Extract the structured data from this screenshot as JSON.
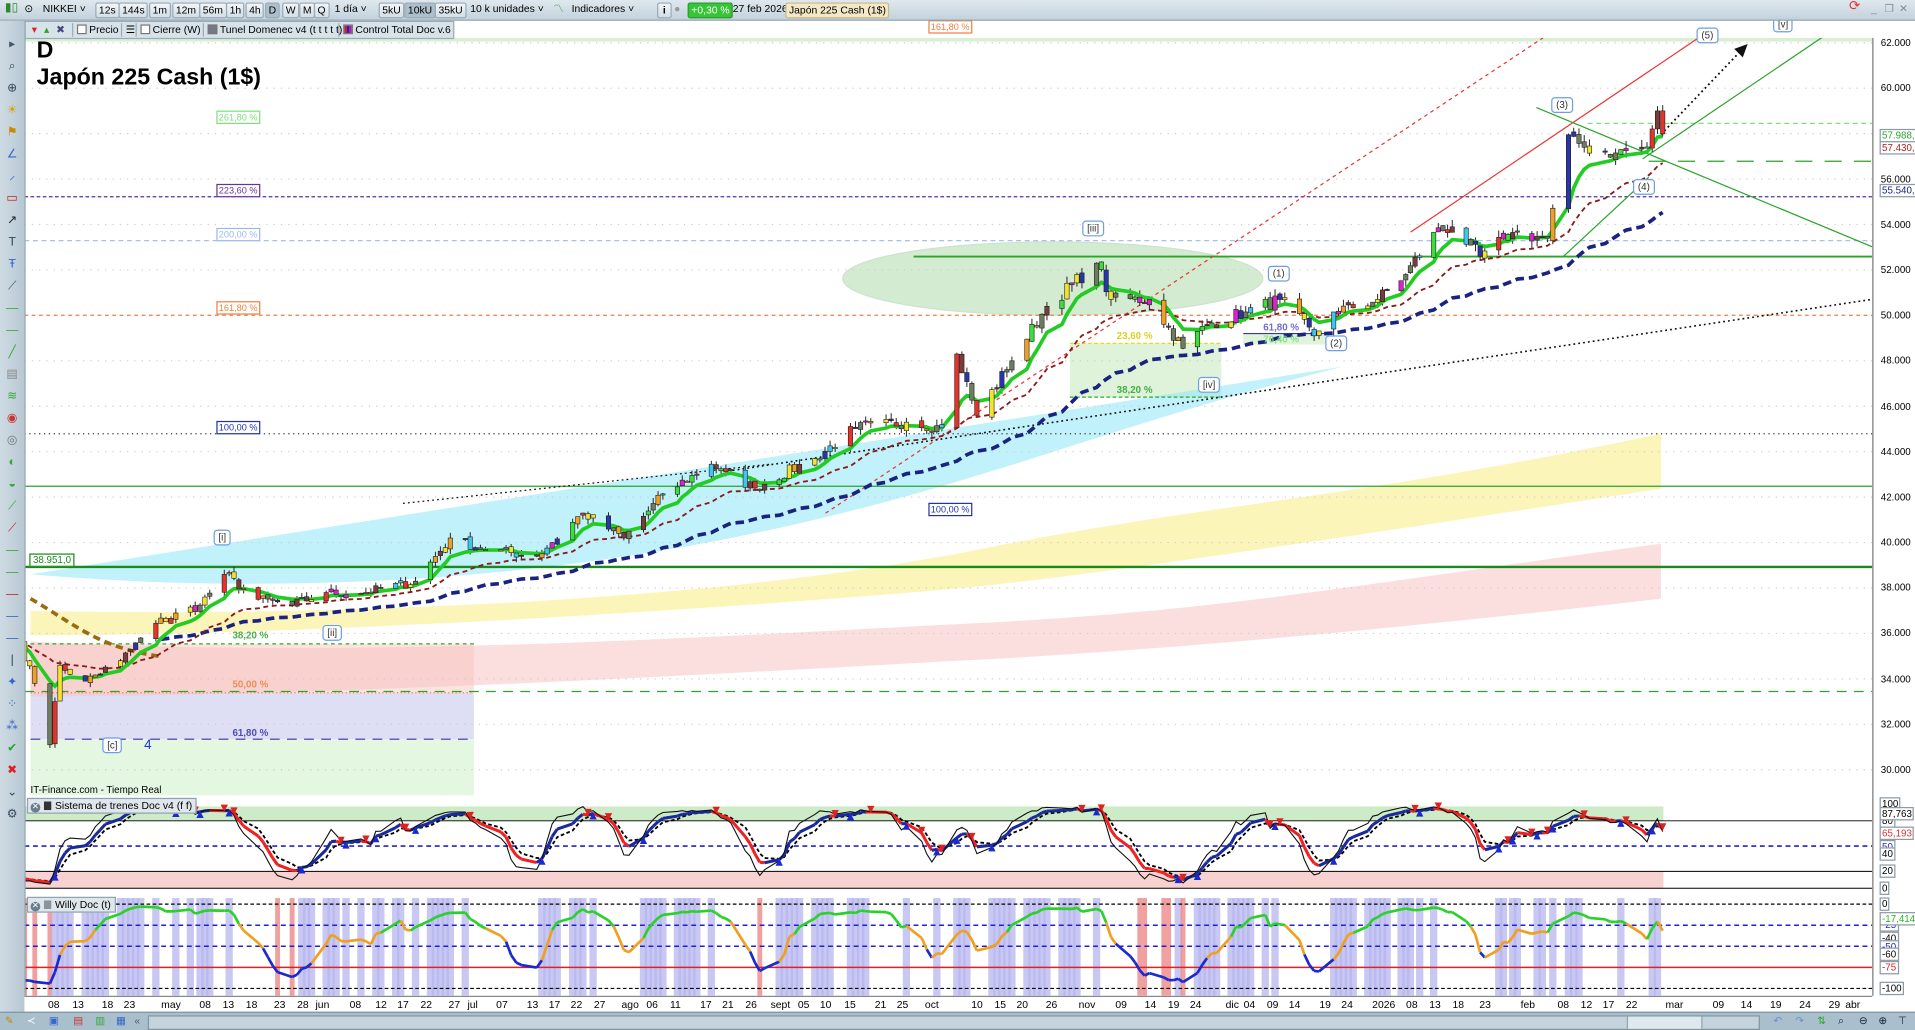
{
  "toolbar": {
    "symbol": "NIKKEI",
    "timeframes": [
      "12s",
      "144s",
      "1m",
      "12m",
      "56m",
      "1h",
      "4h",
      "D",
      "W",
      "M",
      "Q"
    ],
    "active_timeframe": "D",
    "period": "1 día",
    "units": [
      "5kU",
      "10kU",
      "35kU"
    ],
    "active_unit": "10kU",
    "units_select": "10 k unidades",
    "indicators": "Indicadores",
    "info": "i",
    "change": "+0,30 %",
    "date": "27 feb 2026",
    "instrument": "Japón 225 Cash (1$)"
  },
  "legend": {
    "precio": "Precio",
    "cierre": "Cierre (W)",
    "tunel": "Tunel Domenec v4 (t t t t t)",
    "control": "Control Total Doc v.6"
  },
  "chart": {
    "timeframe_label": "D",
    "title": "Japón 225 Cash (1$)",
    "source": "IT-Finance.com - Tiempo Real",
    "level_box": "38.951,0",
    "fib_boxes": [
      "161,80 %",
      "261,80 %",
      "223,60 %",
      "200,00 %",
      "161,80 %",
      "100,00 %",
      "100,00 %"
    ],
    "fib_texts": [
      "38,20 %",
      "50,00 %",
      "61,80 %",
      "23,60 %",
      "38,20 %",
      "61,80 %",
      "76,40 %"
    ],
    "wave_labels": [
      "[i]",
      "[ii]",
      "[iii]",
      "[iv]",
      "[c]",
      "(1)",
      "(2)",
      "(3)",
      "(4)",
      "(5)",
      "[v]"
    ],
    "wave_count": "4"
  },
  "price_axis": {
    "labels": [
      "62.000",
      "60.000",
      "56.000",
      "54.000",
      "52.000",
      "50.000",
      "48.000",
      "46.000",
      "44.000",
      "42.000",
      "40.000",
      "38.000",
      "36.000",
      "34.000",
      "32.000",
      "30.000"
    ],
    "tags": {
      "green": "57.988,1",
      "red": "57.430,2",
      "navy": "55.540,7"
    }
  },
  "panel1": {
    "title": "Sistema de trenes Doc v4 (f f)",
    "labels": [
      "100",
      "80",
      "50",
      "40",
      "20",
      "0"
    ],
    "tags": [
      "87,763",
      "65,193"
    ]
  },
  "panel2": {
    "title": "Willy Doc (t)",
    "labels": [
      "0",
      "-25",
      "-40",
      "-50",
      "-60",
      "-75",
      "-100"
    ],
    "tags": [
      "-17,414"
    ]
  },
  "xaxis": {
    "ticks": [
      "08",
      "13",
      "18",
      "23",
      "may",
      "08",
      "13",
      "18",
      "23",
      "28",
      "jun",
      "08",
      "12",
      "17",
      "22",
      "27",
      "jul",
      "07",
      "13",
      "17",
      "22",
      "27",
      "ago",
      "06",
      "11",
      "17",
      "21",
      "26",
      "sept",
      "05",
      "10",
      "15",
      "21",
      "25",
      "oct",
      "10",
      "15",
      "20",
      "26",
      "nov",
      "09",
      "14",
      "19",
      "24",
      "dic",
      "04",
      "09",
      "14",
      "19",
      "24",
      "2026",
      "08",
      "13",
      "18",
      "23",
      "feb",
      "08",
      "12",
      "17",
      "22",
      "mar",
      "09",
      "14",
      "19",
      "24",
      "29",
      "abr"
    ]
  },
  "colors": {
    "fast_ma": "#22cc22",
    "mid_ma": "#8b1a1a",
    "slow_ma": "#1a237e",
    "up_change": "#33cc33"
  },
  "chart_data": {
    "type": "candlestick",
    "title": "Japón 225 Cash (1$)",
    "timeframe": "D",
    "ylim": [
      29500,
      63000
    ],
    "anchor_closes": [
      [
        "2025-04-01",
        35600
      ],
      [
        "2025-04-04",
        33800
      ],
      [
        "2025-04-07",
        31100
      ],
      [
        "2025-04-08",
        33000
      ],
      [
        "2025-04-09",
        34600
      ],
      [
        "2025-04-14",
        33900
      ],
      [
        "2025-04-21",
        34800
      ],
      [
        "2025-04-28",
        36450
      ],
      [
        "2025-05-07",
        37250
      ],
      [
        "2025-05-12",
        38600
      ],
      [
        "2025-05-19",
        37500
      ],
      [
        "2025-05-26",
        37250
      ],
      [
        "2025-06-02",
        37800
      ],
      [
        "2025-06-10",
        37800
      ],
      [
        "2025-06-20",
        38300
      ],
      [
        "2025-06-27",
        40200
      ],
      [
        "2025-07-04",
        39700
      ],
      [
        "2025-07-14",
        39400
      ],
      [
        "2025-07-23",
        41300
      ],
      [
        "2025-07-31",
        40200
      ],
      [
        "2025-08-08",
        42100
      ],
      [
        "2025-08-18",
        43450
      ],
      [
        "2025-08-27",
        42400
      ],
      [
        "2025-09-08",
        43700
      ],
      [
        "2025-09-16",
        45050
      ],
      [
        "2025-09-26",
        45300
      ],
      [
        "2025-10-03",
        45050
      ],
      [
        "2025-10-06",
        48300
      ],
      [
        "2025-10-10",
        45600
      ],
      [
        "2025-10-17",
        48000
      ],
      [
        "2025-10-24",
        50400
      ],
      [
        "2025-11-03",
        52300
      ],
      [
        "2025-11-06",
        50700
      ],
      [
        "2025-11-14",
        50700
      ],
      [
        "2025-11-21",
        48550
      ],
      [
        "2025-11-26",
        49600
      ],
      [
        "2025-12-04",
        50150
      ],
      [
        "2025-12-11",
        50700
      ],
      [
        "2025-12-18",
        49100
      ],
      [
        "2025-12-22",
        50150
      ],
      [
        "2025-12-31",
        50700
      ],
      [
        "2026-01-06",
        51800
      ],
      [
        "2026-01-12",
        53650
      ],
      [
        "2026-01-16",
        53900
      ],
      [
        "2026-01-22",
        52600
      ],
      [
        "2026-01-29",
        53650
      ],
      [
        "2026-02-05",
        53400
      ],
      [
        "2026-02-09",
        57950
      ],
      [
        "2026-02-12",
        57400
      ],
      [
        "2026-02-18",
        57150
      ],
      [
        "2026-02-24",
        57400
      ],
      [
        "2026-02-26",
        59000
      ],
      [
        "2026-02-27",
        57988
      ]
    ],
    "horizontal_levels": [
      38951,
      42500,
      52600,
      33500
    ],
    "last": 57988.1
  }
}
